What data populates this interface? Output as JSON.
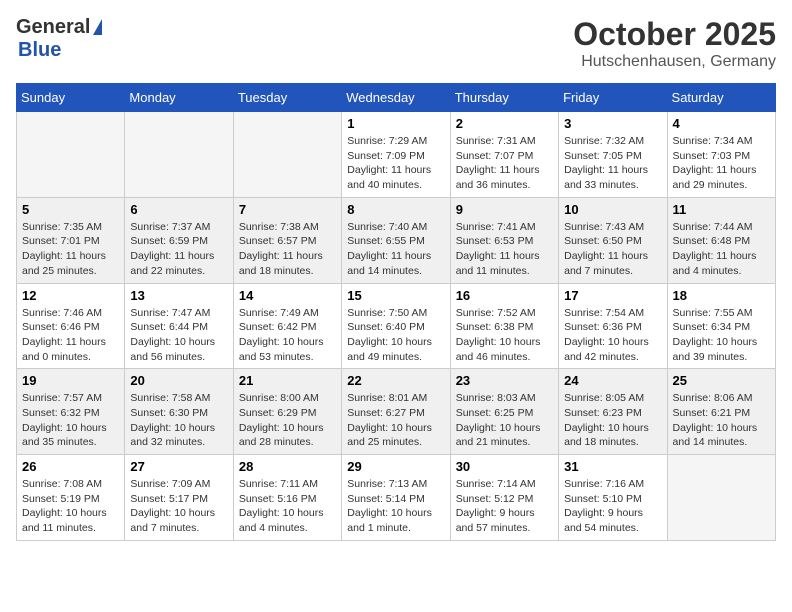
{
  "logo": {
    "general": "General",
    "blue": "Blue"
  },
  "title": "October 2025",
  "location": "Hutschenhausen, Germany",
  "days_of_week": [
    "Sunday",
    "Monday",
    "Tuesday",
    "Wednesday",
    "Thursday",
    "Friday",
    "Saturday"
  ],
  "weeks": [
    [
      {
        "num": "",
        "info": ""
      },
      {
        "num": "",
        "info": ""
      },
      {
        "num": "",
        "info": ""
      },
      {
        "num": "1",
        "info": "Sunrise: 7:29 AM\nSunset: 7:09 PM\nDaylight: 11 hours\nand 40 minutes."
      },
      {
        "num": "2",
        "info": "Sunrise: 7:31 AM\nSunset: 7:07 PM\nDaylight: 11 hours\nand 36 minutes."
      },
      {
        "num": "3",
        "info": "Sunrise: 7:32 AM\nSunset: 7:05 PM\nDaylight: 11 hours\nand 33 minutes."
      },
      {
        "num": "4",
        "info": "Sunrise: 7:34 AM\nSunset: 7:03 PM\nDaylight: 11 hours\nand 29 minutes."
      }
    ],
    [
      {
        "num": "5",
        "info": "Sunrise: 7:35 AM\nSunset: 7:01 PM\nDaylight: 11 hours\nand 25 minutes."
      },
      {
        "num": "6",
        "info": "Sunrise: 7:37 AM\nSunset: 6:59 PM\nDaylight: 11 hours\nand 22 minutes."
      },
      {
        "num": "7",
        "info": "Sunrise: 7:38 AM\nSunset: 6:57 PM\nDaylight: 11 hours\nand 18 minutes."
      },
      {
        "num": "8",
        "info": "Sunrise: 7:40 AM\nSunset: 6:55 PM\nDaylight: 11 hours\nand 14 minutes."
      },
      {
        "num": "9",
        "info": "Sunrise: 7:41 AM\nSunset: 6:53 PM\nDaylight: 11 hours\nand 11 minutes."
      },
      {
        "num": "10",
        "info": "Sunrise: 7:43 AM\nSunset: 6:50 PM\nDaylight: 11 hours\nand 7 minutes."
      },
      {
        "num": "11",
        "info": "Sunrise: 7:44 AM\nSunset: 6:48 PM\nDaylight: 11 hours\nand 4 minutes."
      }
    ],
    [
      {
        "num": "12",
        "info": "Sunrise: 7:46 AM\nSunset: 6:46 PM\nDaylight: 11 hours\nand 0 minutes."
      },
      {
        "num": "13",
        "info": "Sunrise: 7:47 AM\nSunset: 6:44 PM\nDaylight: 10 hours\nand 56 minutes."
      },
      {
        "num": "14",
        "info": "Sunrise: 7:49 AM\nSunset: 6:42 PM\nDaylight: 10 hours\nand 53 minutes."
      },
      {
        "num": "15",
        "info": "Sunrise: 7:50 AM\nSunset: 6:40 PM\nDaylight: 10 hours\nand 49 minutes."
      },
      {
        "num": "16",
        "info": "Sunrise: 7:52 AM\nSunset: 6:38 PM\nDaylight: 10 hours\nand 46 minutes."
      },
      {
        "num": "17",
        "info": "Sunrise: 7:54 AM\nSunset: 6:36 PM\nDaylight: 10 hours\nand 42 minutes."
      },
      {
        "num": "18",
        "info": "Sunrise: 7:55 AM\nSunset: 6:34 PM\nDaylight: 10 hours\nand 39 minutes."
      }
    ],
    [
      {
        "num": "19",
        "info": "Sunrise: 7:57 AM\nSunset: 6:32 PM\nDaylight: 10 hours\nand 35 minutes."
      },
      {
        "num": "20",
        "info": "Sunrise: 7:58 AM\nSunset: 6:30 PM\nDaylight: 10 hours\nand 32 minutes."
      },
      {
        "num": "21",
        "info": "Sunrise: 8:00 AM\nSunset: 6:29 PM\nDaylight: 10 hours\nand 28 minutes."
      },
      {
        "num": "22",
        "info": "Sunrise: 8:01 AM\nSunset: 6:27 PM\nDaylight: 10 hours\nand 25 minutes."
      },
      {
        "num": "23",
        "info": "Sunrise: 8:03 AM\nSunset: 6:25 PM\nDaylight: 10 hours\nand 21 minutes."
      },
      {
        "num": "24",
        "info": "Sunrise: 8:05 AM\nSunset: 6:23 PM\nDaylight: 10 hours\nand 18 minutes."
      },
      {
        "num": "25",
        "info": "Sunrise: 8:06 AM\nSunset: 6:21 PM\nDaylight: 10 hours\nand 14 minutes."
      }
    ],
    [
      {
        "num": "26",
        "info": "Sunrise: 7:08 AM\nSunset: 5:19 PM\nDaylight: 10 hours\nand 11 minutes."
      },
      {
        "num": "27",
        "info": "Sunrise: 7:09 AM\nSunset: 5:17 PM\nDaylight: 10 hours\nand 7 minutes."
      },
      {
        "num": "28",
        "info": "Sunrise: 7:11 AM\nSunset: 5:16 PM\nDaylight: 10 hours\nand 4 minutes."
      },
      {
        "num": "29",
        "info": "Sunrise: 7:13 AM\nSunset: 5:14 PM\nDaylight: 10 hours\nand 1 minute."
      },
      {
        "num": "30",
        "info": "Sunrise: 7:14 AM\nSunset: 5:12 PM\nDaylight: 9 hours\nand 57 minutes."
      },
      {
        "num": "31",
        "info": "Sunrise: 7:16 AM\nSunset: 5:10 PM\nDaylight: 9 hours\nand 54 minutes."
      },
      {
        "num": "",
        "info": ""
      }
    ]
  ]
}
